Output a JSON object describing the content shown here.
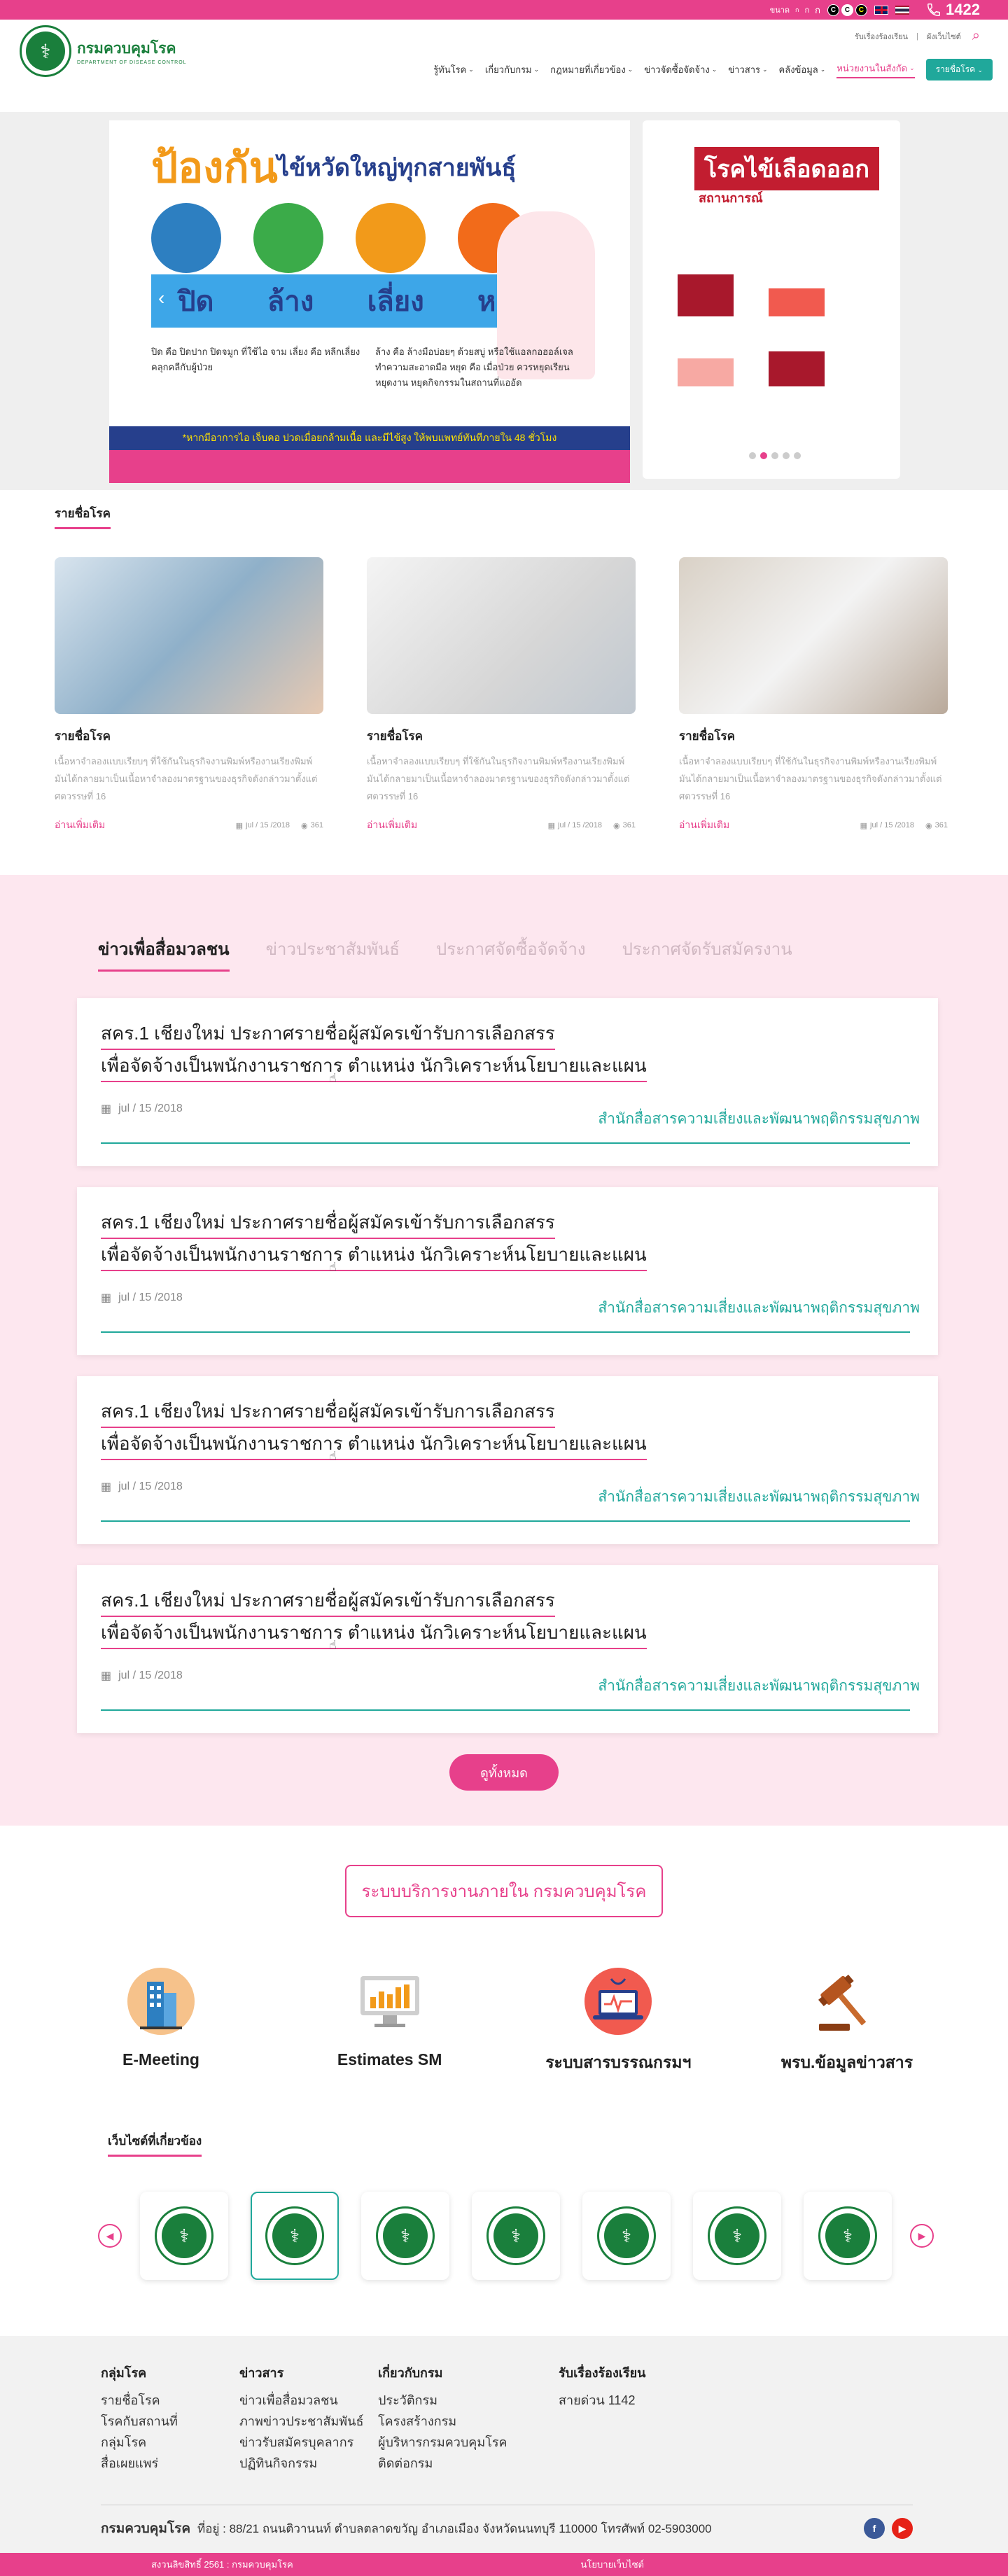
{
  "topbar": {
    "font_small": "ก",
    "font_medium": "ก",
    "font_large": "ก",
    "font_label": "ขนาด",
    "contrast": [
      "C",
      "C",
      "C"
    ],
    "hotline": "1422"
  },
  "header": {
    "logo_th": "กรมควบคุมโรค",
    "logo_en": "DEPARTMENT OF DISEASE CONTROL",
    "util": [
      "รับเรื่องร้องเรียน",
      "ผังเว็บไซต์"
    ],
    "nav": [
      "รู้ทันโรค",
      "เกี่ยวกับกรม",
      "กฎหมายที่เกี่ยวข้อง",
      "ข่าวจัดซื้อจัดจ้าง",
      "ข่าวสาร",
      "คลังข้อมูล",
      "หน่วยงานในสังกัด"
    ],
    "sites_button": "รายชื่อโรค"
  },
  "hero": {
    "headline": "ป้องกัน",
    "headline2": "ไข้หวัดใหญ่ทุกสายพันธุ์",
    "steps": [
      "ปิด",
      "ล้าง",
      "เลี่ยง",
      "หยุด"
    ],
    "desc_left": "ปิด คือ ปิดปาก ปิดจมูก ที่ใช้ไอ จาม เลี่ยง คือ หลีกเลี่ยงคลุกคลีกับผู้ป่วย",
    "desc_right": "ล้าง คือ ล้างมือบ่อยๆ ด้วยสบู่ หรือใช้แอลกอฮอล์เจลทำความสะอาดมือ หยุด คือ เมื่อป่วย ควรหยุดเรียน หยุดงาน หยุดกิจกรรมในสถานที่แออัด",
    "notice": "*หากมีอาการไอ เจ็บคอ ปวดเมื่อยกล้ามเนื้อ และมีไข้สูง ให้พบแพทย์ทันทีภายใน 48 ชั่วโมง",
    "side_title": "โรคไข้เลือดออก",
    "side_subtitle": "สถานการณ์",
    "dot_count": 5,
    "active_dot": 1
  },
  "disease_section": {
    "title": "รายชื่อโรค",
    "cards": [
      {
        "title": "รายชื่อโรค",
        "body": "เนื้อหาจำลองแบบเรียบๆ ที่ใช้กันในธุรกิจงานพิมพ์หรืองานเรียงพิมพ์ มันได้กลายมาเป็นเนื้อหาจำลองมาตรฐานของธุรกิจดังกล่าวมาตั้งแต่ศตวรรษที่ 16",
        "more": "อ่านเพิ่มเติม",
        "date": "jul / 15 /2018",
        "views": "361"
      },
      {
        "title": "รายชื่อโรค",
        "body": "เนื้อหาจำลองแบบเรียบๆ ที่ใช้กันในธุรกิจงานพิมพ์หรืองานเรียงพิมพ์ มันได้กลายมาเป็นเนื้อหาจำลองมาตรฐานของธุรกิจดังกล่าวมาตั้งแต่ศตวรรษที่ 16",
        "more": "อ่านเพิ่มเติม",
        "date": "jul / 15 /2018",
        "views": "361"
      },
      {
        "title": "รายชื่อโรค",
        "body": "เนื้อหาจำลองแบบเรียบๆ ที่ใช้กันในธุรกิจงานพิมพ์หรืองานเรียงพิมพ์ มันได้กลายมาเป็นเนื้อหาจำลองมาตรฐานของธุรกิจดังกล่าวมาตั้งแต่ศตวรรษที่ 16",
        "more": "อ่านเพิ่มเติม",
        "date": "jul / 15 /2018",
        "views": "361"
      }
    ]
  },
  "news": {
    "tabs": [
      "ข่าวเพื่อสื่อมวลชน",
      "ข่าวประชาสัมพันธ์",
      "ประกาศจัดซื้อจัดจ้าง",
      "ประกาศจัดรับสมัครงาน"
    ],
    "items": [
      {
        "line1": "สคร.1 เชียงใหม่ ประกาศรายชื่อผู้สมัครเข้ารับการเลือกสรร",
        "line2": "เพื่อจัดจ้างเป็นพนักงานราชการ ตำแหน่ง นักวิเคราะห์นโยบายและแผน",
        "date": "jul / 15 /2018",
        "dept": "สำนักสื่อสารความเสี่ยงและพัฒนาพฤติกรรมสุขภาพ"
      },
      {
        "line1": "สคร.1 เชียงใหม่ ประกาศรายชื่อผู้สมัครเข้ารับการเลือกสรร",
        "line2": "เพื่อจัดจ้างเป็นพนักงานราชการ ตำแหน่ง นักวิเคราะห์นโยบายและแผน",
        "date": "jul / 15 /2018",
        "dept": "สำนักสื่อสารความเสี่ยงและพัฒนาพฤติกรรมสุขภาพ"
      },
      {
        "line1": "สคร.1 เชียงใหม่ ประกาศรายชื่อผู้สมัครเข้ารับการเลือกสรร",
        "line2": "เพื่อจัดจ้างเป็นพนักงานราชการ ตำแหน่ง นักวิเคราะห์นโยบายและแผน",
        "date": "jul / 15 /2018",
        "dept": "สำนักสื่อสารความเสี่ยงและพัฒนาพฤติกรรมสุขภาพ"
      },
      {
        "line1": "สคร.1 เชียงใหม่ ประกาศรายชื่อผู้สมัครเข้ารับการเลือกสรร",
        "line2": "เพื่อจัดจ้างเป็นพนักงานราชการ ตำแหน่ง นักวิเคราะห์นโยบายและแผน",
        "date": "jul / 15 /2018",
        "dept": "สำนักสื่อสารความเสี่ยงและพัฒนาพฤติกรรมสุขภาพ"
      }
    ],
    "view_all": "ดูทั้งหมด"
  },
  "systems": {
    "title": "ระบบบริการงานภายใน กรมควบคุมโรค",
    "items": [
      {
        "label": "E-Meeting",
        "icon": "building-icon"
      },
      {
        "label": "Estimates SM",
        "icon": "monitor-chart-icon"
      },
      {
        "label": "ระบบสารบรรณกรมฯ",
        "icon": "laptop-stethoscope-icon"
      },
      {
        "label": "พรบ.ข้อมูลข่าวสาร",
        "icon": "gavel-icon"
      }
    ]
  },
  "related": {
    "title": "เว็บไซต์ที่เกี่ยวข้อง",
    "count": 7,
    "selected": 1
  },
  "footer": {
    "cols": [
      {
        "title": "กลุ่มโรค",
        "links": [
          "รายชื่อโรค",
          "โรคกับสถานที่",
          "กลุ่มโรค",
          "สื่อเผยแพร่"
        ]
      },
      {
        "title": "ข่าวสาร",
        "links": [
          "ข่าวเพื่อสื่อมวลชน",
          "ภาพข่าวประชาสัมพันธ์",
          "ข่าวรับสมัครบุคลากร",
          "ปฏิทินกิจกรรม"
        ]
      },
      {
        "title": "เกี่ยวกับกรม",
        "links": [
          "ประวัติกรม",
          "โครงสร้างกรม",
          "ผู้บริหารกรมควบคุมโรค",
          "ติดต่อกรม"
        ]
      },
      {
        "title": "รับเรื่องร้องเรียน",
        "links": [
          "สายด่วน 1142"
        ]
      }
    ],
    "org": "กรมควบคุมโรค",
    "address": "ที่อยู่ : 88/21 ถนนติวานนท์ ตำบลตลาดขวัญ อำเภอเมือง จังหวัดนนทบุรี 110000 โทรศัพท์ 02-5903000",
    "copyright": "สงวนลิขสิทธิ์ 2561 : กรมควบคุมโรค",
    "policy": "นโยบายเว็บไซต์"
  },
  "colors": {
    "brand_pink": "#e7408b",
    "brand_teal": "#20a89b",
    "brand_green": "#1a7f3c"
  }
}
